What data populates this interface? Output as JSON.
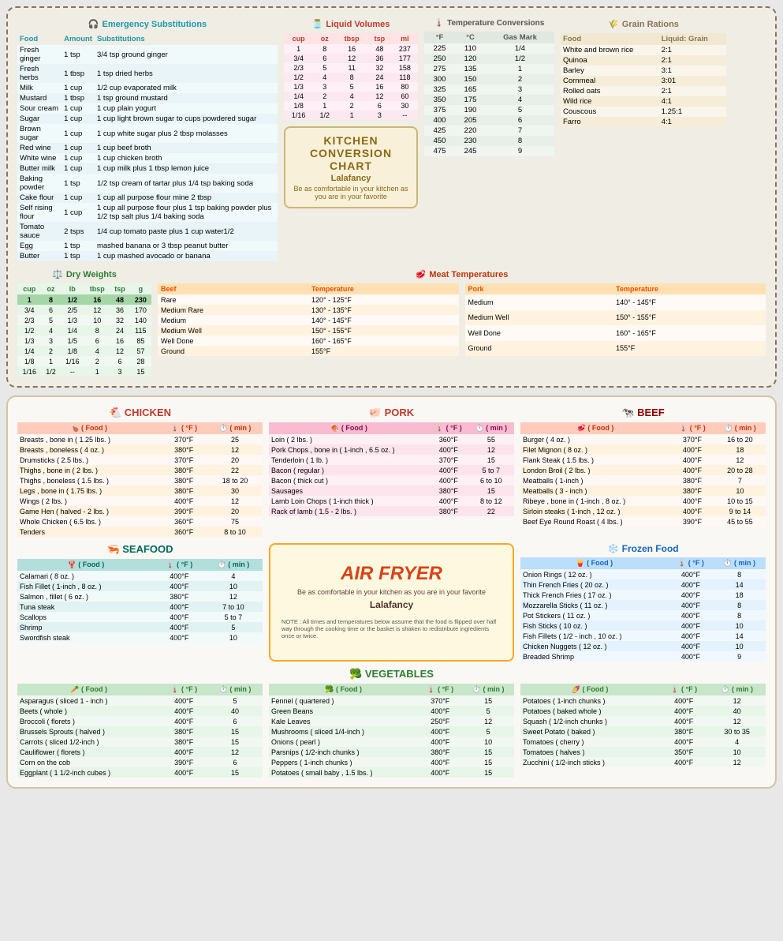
{
  "top_card": {
    "emergency_title": "Emergency Substitutions",
    "emergency_icon": "🎧",
    "emergency_headers": [
      "Food",
      "Amount",
      "Substitutions"
    ],
    "emergency_rows": [
      [
        "Fresh ginger",
        "1 tsp",
        "3/4 tsp ground ginger"
      ],
      [
        "Fresh herbs",
        "1 tbsp",
        "1 tsp dried herbs"
      ],
      [
        "Milk",
        "1 cup",
        "1/2 cup evaporated milk"
      ],
      [
        "Mustard",
        "1 tbsp",
        "1 tsp ground mustard"
      ],
      [
        "Sour cream",
        "1 cup",
        "1 cup plain yogurt"
      ],
      [
        "Sugar",
        "1 cup",
        "1 cup light brown sugar to cups powdered sugar"
      ],
      [
        "Brown sugar",
        "1 cup",
        "1 cup white sugar plus 2 tbsp molasses"
      ],
      [
        "Red wine",
        "1 cup",
        "1 cup beef broth"
      ],
      [
        "White wine",
        "1 cup",
        "1 cup chicken broth"
      ],
      [
        "Butter milk",
        "1 cup",
        "1 cup milk plus 1 tbsp lemon juice"
      ],
      [
        "Baking powder",
        "1 tsp",
        "1/2 tsp cream of tartar plus 1/4 tsp baking soda"
      ],
      [
        "Cake flour",
        "1 cup",
        "1 cup all purpose flour mine 2 tbsp"
      ],
      [
        "Self rising flour",
        "1 cup",
        "1 cup all purpose flour plus 1 tsp baking powder plus 1/2 tsp salt plus 1/4 baking soda"
      ],
      [
        "Tomato sauce",
        "2 tsps",
        "1/4 cup tomato paste plus 1 cup water1/2"
      ],
      [
        "Egg",
        "1 tsp",
        "mashed banana or 3 tbsp peanut butter"
      ],
      [
        "Butter",
        "1 tsp",
        "1 cup mashed avocado or banana"
      ]
    ],
    "liquid_title": "Liquid Volumes",
    "liquid_icon": "🫙",
    "liquid_headers": [
      "cup",
      "oz",
      "tbsp",
      "tsp",
      "ml"
    ],
    "liquid_rows": [
      [
        "1",
        "8",
        "16",
        "48",
        "237"
      ],
      [
        "3/4",
        "6",
        "12",
        "36",
        "177"
      ],
      [
        "2/3",
        "5",
        "11",
        "32",
        "158"
      ],
      [
        "1/2",
        "4",
        "8",
        "24",
        "118"
      ],
      [
        "1/3",
        "3",
        "5",
        "16",
        "80"
      ],
      [
        "1/4",
        "2",
        "4",
        "12",
        "60"
      ],
      [
        "1/8",
        "1",
        "2",
        "6",
        "30"
      ],
      [
        "1/16",
        "1/2",
        "1",
        "3",
        "--"
      ]
    ],
    "temp_title": "Temperature Conversions",
    "temp_icon": "🌡️",
    "temp_headers": [
      "°F",
      "°C",
      "Gas Mark"
    ],
    "temp_rows": [
      [
        "225",
        "110",
        "1/4"
      ],
      [
        "250",
        "120",
        "1/2"
      ],
      [
        "275",
        "135",
        "1"
      ],
      [
        "300",
        "150",
        "2"
      ],
      [
        "325",
        "165",
        "3"
      ],
      [
        "350",
        "175",
        "4"
      ],
      [
        "375",
        "190",
        "5"
      ],
      [
        "400",
        "205",
        "6"
      ],
      [
        "425",
        "220",
        "7"
      ],
      [
        "450",
        "230",
        "8"
      ],
      [
        "475",
        "245",
        "9"
      ]
    ],
    "grain_title": "Grain Rations",
    "grain_icon": "🌾",
    "grain_headers": [
      "Food",
      "Liquid: Grain"
    ],
    "grain_rows": [
      [
        "White and brown rice",
        "2:1"
      ],
      [
        "Quinoa",
        "2:1"
      ],
      [
        "Barley",
        "3:1"
      ],
      [
        "Cornmeal",
        "3:01"
      ],
      [
        "Rolled oats",
        "2:1"
      ],
      [
        "Wild rice",
        "4:1"
      ],
      [
        "Couscous",
        "1.25:1"
      ],
      [
        "Farro",
        "4:1"
      ]
    ],
    "kitchen_chart_title": "KITCHEN CONVERSION CHART",
    "kitchen_chart_brand": "Lalafancy",
    "kitchen_chart_sub": "Be as comfortable in your kitchen as you are in your favorite",
    "dry_title": "Dry Weights",
    "dry_icon": "⚖️",
    "dry_headers": [
      "cup",
      "oz",
      "lb",
      "tbsp",
      "tsp",
      "g"
    ],
    "dry_rows": [
      [
        "1",
        "8",
        "1/2",
        "16",
        "48",
        "230"
      ],
      [
        "3/4",
        "6",
        "2/5",
        "12",
        "36",
        "170"
      ],
      [
        "2/3",
        "5",
        "1/3",
        "10",
        "32",
        "140"
      ],
      [
        "1/2",
        "4",
        "1/4",
        "8",
        "24",
        "115"
      ],
      [
        "1/3",
        "3",
        "1/5",
        "6",
        "16",
        "85"
      ],
      [
        "1/4",
        "2",
        "1/8",
        "4",
        "12",
        "57"
      ],
      [
        "1/8",
        "1",
        "1/16",
        "2",
        "6",
        "28"
      ],
      [
        "1/16",
        "1/2",
        "--",
        "1",
        "3",
        "15"
      ]
    ],
    "meat_temp_title": "Meat Temperatures",
    "meat_temp_icon": "🥩",
    "beef_headers": [
      "Beef",
      "Temperature"
    ],
    "beef_rows": [
      [
        "Rare",
        "120° - 125°F"
      ],
      [
        "Medium Rare",
        "130° - 135°F"
      ],
      [
        "Medium",
        "140° - 145°F"
      ],
      [
        "Medium Well",
        "150° - 155°F"
      ],
      [
        "Well Done",
        "160° - 165°F"
      ],
      [
        "Ground",
        "155°F"
      ]
    ],
    "pork_headers": [
      "Pork",
      "Temperature"
    ],
    "pork_rows": [
      [
        "Medium",
        "140° - 145°F"
      ],
      [
        "Medium Well",
        "150° - 155°F"
      ],
      [
        "Well Done",
        "160° - 165°F"
      ],
      [
        "Ground",
        "155°F"
      ]
    ]
  },
  "bottom_card": {
    "chicken_title": "CHICKEN",
    "chicken_icon": "🐔",
    "food_col": "( Food )",
    "temp_col": "( °F )",
    "min_col": "( min )",
    "chicken_rows": [
      [
        "Breasts , bone in ( 1.25 lbs. )",
        "370°F",
        "25"
      ],
      [
        "Breasts , boneless ( 4 oz. )",
        "380°F",
        "12"
      ],
      [
        "Drumsticks ( 2.5 lbs. )",
        "370°F",
        "20"
      ],
      [
        "Thighs , bone in ( 2 lbs. )",
        "380°F",
        "22"
      ],
      [
        "Thighs , boneless ( 1.5 lbs. )",
        "380°F",
        "18 to 20"
      ],
      [
        "Legs , bone in ( 1.75 lbs. )",
        "380°F",
        "30"
      ],
      [
        "Wings ( 2 lbs. )",
        "400°F",
        "12"
      ],
      [
        "Game Hen ( halved - 2 lbs. )",
        "390°F",
        "20"
      ],
      [
        "Whole Chicken ( 6.5 lbs. )",
        "360°F",
        "75"
      ],
      [
        "Tenders",
        "360°F",
        "8 to 10"
      ]
    ],
    "pork_title": "PORK",
    "pork_icon": "🐖",
    "pork_rows": [
      [
        "Loin ( 2 lbs. )",
        "360°F",
        "55"
      ],
      [
        "Pork Chops , bone in ( 1-inch , 6.5 oz. )",
        "400°F",
        "12"
      ],
      [
        "Tenderloin ( 1 lb. )",
        "370°F",
        "15"
      ],
      [
        "Bacon ( regular )",
        "400°F",
        "5 to 7"
      ],
      [
        "Bacon ( thick cut )",
        "400°F",
        "6 to 10"
      ],
      [
        "Sausages",
        "380°F",
        "15"
      ],
      [
        "Lamb Loin Chops ( 1-inch thick )",
        "400°F",
        "8 to 12"
      ],
      [
        "Rack of lamb ( 1.5 - 2 lbs. )",
        "380°F",
        "22"
      ]
    ],
    "beef_title": "BEEF",
    "beef_icon": "🐄",
    "beef_rows": [
      [
        "Burger ( 4 oz. )",
        "370°F",
        "16 to 20"
      ],
      [
        "Filet Mignon ( 8 oz. )",
        "400°F",
        "18"
      ],
      [
        "Flank Steak ( 1.5 lbs. )",
        "400°F",
        "12"
      ],
      [
        "London Broil ( 2 lbs. )",
        "400°F",
        "20 to 28"
      ],
      [
        "Meatballs ( 1-inch )",
        "380°F",
        "7"
      ],
      [
        "Meatballs ( 3 - inch )",
        "380°F",
        "10"
      ],
      [
        "Ribeye , bone in ( 1-inch , 8 oz. )",
        "400°F",
        "10 to 15"
      ],
      [
        "Sirloin steaks ( 1-inch , 12 oz. )",
        "400°F",
        "9 to 14"
      ],
      [
        "Beef Eye Round Roast ( 4 lbs. )",
        "390°F",
        "45 to 55"
      ]
    ],
    "seafood_title": "SEAFOOD",
    "seafood_icon": "🦐",
    "seafood_rows": [
      [
        "Calamari ( 8 oz. )",
        "400°F",
        "4"
      ],
      [
        "Fish Fillet ( 1-inch , 8 oz. )",
        "400°F",
        "10"
      ],
      [
        "Salmon , fillet ( 6 oz. )",
        "380°F",
        "12"
      ],
      [
        "Tuna steak",
        "400°F",
        "7 to 10"
      ],
      [
        "Scallops",
        "400°F",
        "5 to 7"
      ],
      [
        "Shrimp",
        "400°F",
        "5"
      ],
      [
        "Swordfish steak",
        "400°F",
        "10"
      ]
    ],
    "frozen_title": "Frozen Food",
    "frozen_icon": "❄️",
    "frozen_rows": [
      [
        "Onion Rings ( 12 oz. )",
        "400°F",
        "8"
      ],
      [
        "Thin French Fries ( 20 oz. )",
        "400°F",
        "14"
      ],
      [
        "Thick French Fries ( 17 oz. )",
        "400°F",
        "18"
      ],
      [
        "Mozzarella Sticks ( 11 oz. )",
        "400°F",
        "8"
      ],
      [
        "Pot Stickers ( 11 oz. )",
        "400°F",
        "8"
      ],
      [
        "Fish Sticks ( 10 oz. )",
        "400°F",
        "10"
      ],
      [
        "Fish Fillets ( 1/2 - inch , 10 oz. )",
        "400°F",
        "14"
      ],
      [
        "Chicken Nuggets ( 12 oz. )",
        "400°F",
        "10"
      ],
      [
        "Breaded Shrimp",
        "400°F",
        "9"
      ]
    ],
    "air_fryer_title": "AIR FRYER",
    "air_fryer_sub": "Be as comfortable in your kitchen as you are in your favorite",
    "air_fryer_brand": "Lalafancy",
    "air_fryer_note": "NOTE : All times and temperatures below assume that the food is flipped over half way through the cooking time or the basket is shaken to redistribute ingredients once or twice.",
    "veggies_title": "VEGETABLES",
    "veggies_icon": "🥦",
    "veggies1_rows": [
      [
        "Asparagus ( sliced 1 - inch )",
        "400°F",
        "5"
      ],
      [
        "Beets ( whole )",
        "400°F",
        "40"
      ],
      [
        "Broccoli ( florets )",
        "400°F",
        "6"
      ],
      [
        "Brussels Sprouts ( halved )",
        "380°F",
        "15"
      ],
      [
        "Carrots ( sliced 1/2-inch )",
        "380°F",
        "15"
      ],
      [
        "Cauliflower ( florets )",
        "400°F",
        "12"
      ],
      [
        "Corn on the cob",
        "390°F",
        "6"
      ],
      [
        "Eggplant ( 1 1/2-inch cubes )",
        "400°F",
        "15"
      ]
    ],
    "veggies2_rows": [
      [
        "Fennel ( quartered )",
        "370°F",
        "15"
      ],
      [
        "Green Beans",
        "400°F",
        "5"
      ],
      [
        "Kale Leaves",
        "250°F",
        "12"
      ],
      [
        "Mushrooms ( sliced 1/4-inch )",
        "400°F",
        "5"
      ],
      [
        "Onions ( pearl )",
        "400°F",
        "10"
      ],
      [
        "Parsnips ( 1/2-inch chunks )",
        "380°F",
        "15"
      ],
      [
        "Peppers ( 1-inch chunks )",
        "400°F",
        "15"
      ],
      [
        "Potatoes ( small baby , 1.5 lbs. )",
        "400°F",
        "15"
      ]
    ],
    "veggies3_rows": [
      [
        "Potatoes ( 1-inch chunks )",
        "400°F",
        "12"
      ],
      [
        "Potatoes ( baked whole )",
        "400°F",
        "40"
      ],
      [
        "Squash ( 1/2-inch chunks )",
        "400°F",
        "12"
      ],
      [
        "Sweet Potato ( baked )",
        "380°F",
        "30 to 35"
      ],
      [
        "Tomatoes ( cherry )",
        "400°F",
        "4"
      ],
      [
        "Tomatoes ( halves )",
        "350°F",
        "10"
      ],
      [
        "Zucchini ( 1/2-inch sticks )",
        "400°F",
        "12"
      ]
    ]
  }
}
